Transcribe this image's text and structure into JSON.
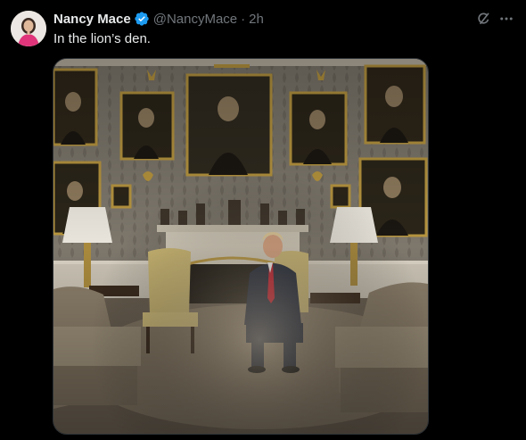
{
  "tweet": {
    "display_name": "Nancy Mace",
    "handle": "@NancyMace",
    "separator": "·",
    "time": "2h",
    "text": "In the lion’s den."
  },
  "icons": {
    "verified": "verified-badge-icon",
    "grok": "grok-icon",
    "more": "more-options-icon"
  },
  "colors": {
    "background": "#000000",
    "primary_text": "#e7e9ea",
    "secondary_text": "#71767b",
    "verified_blue": "#1d9bf0",
    "border": "#2f3336"
  }
}
